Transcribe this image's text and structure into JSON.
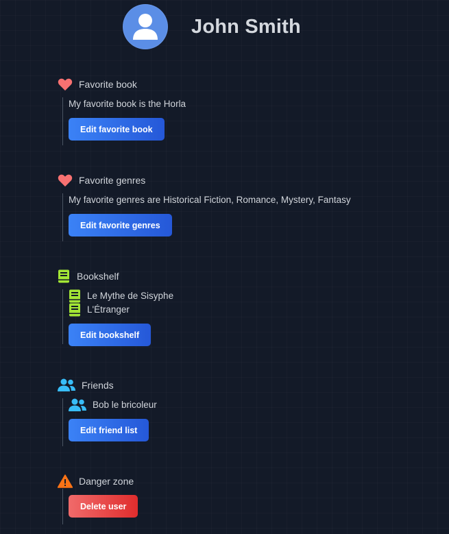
{
  "user": {
    "name": "John Smith",
    "avatar_icon": "user-avatar-icon"
  },
  "favorite_book": {
    "title": "Favorite book",
    "icon": "heart-icon",
    "text": "My favorite book is the Horla",
    "button_label": "Edit favorite book"
  },
  "favorite_genres": {
    "title": "Favorite genres",
    "icon": "heart-icon",
    "text": "My favorite genres are Historical Fiction, Romance, Mystery, Fantasy",
    "button_label": "Edit favorite genres"
  },
  "bookshelf": {
    "title": "Bookshelf",
    "icon": "book-icon",
    "books": [
      "Le Mythe de Sisyphe",
      "L'Étranger"
    ],
    "button_label": "Edit bookshelf"
  },
  "friends": {
    "title": "Friends",
    "icon": "users-icon",
    "list": [
      "Bob le bricoleur"
    ],
    "button_label": "Edit friend list"
  },
  "danger_zone": {
    "title": "Danger zone",
    "icon": "warning-icon",
    "button_label": "Delete user"
  },
  "colors": {
    "background": "#131a28",
    "heart": "#f87171",
    "book": "#a3e635",
    "users": "#38bdf8",
    "warning": "#f97316",
    "primary_button": "#2f6ee8",
    "danger_button": "#e53935"
  }
}
